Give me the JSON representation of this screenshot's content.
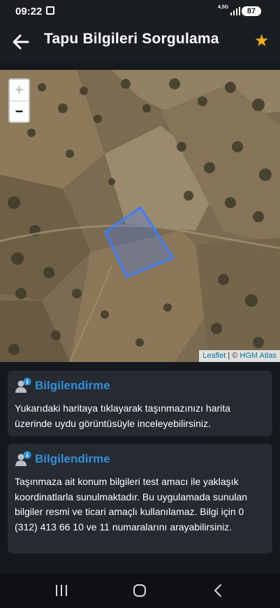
{
  "status": {
    "time": "09:22",
    "network": "4,5G",
    "battery": "87"
  },
  "appbar": {
    "title": "Tapu Bilgileri Sorgulama"
  },
  "map": {
    "zoom_in": "+",
    "zoom_out": "−",
    "attribution_leaflet": "Leaflet",
    "attribution_sep": " | © ",
    "attribution_source": "HGM Atlas"
  },
  "cards": [
    {
      "heading": "Bilgilendirme",
      "body": "Yukarıdaki haritaya tıklayarak taşınmazınızı harita üzerinde uydu görüntüsüyle inceleyebilirsiniz."
    },
    {
      "heading": "Bilgilendirme",
      "body": "Taşınmaza ait konum bilgileri test amacı ile yaklaşık koordinatlarla sunulmaktadır. Bu uygulamada sunulan bilgiler resmi ve ticari amaçlı kullanılamaz. Bilgi için 0 (312) 413 66 10 ve 11 numaralarını arayabilirsiniz."
    }
  ],
  "colors": {
    "accent": "#2f91dc",
    "star": "#f5b014",
    "parcel": "#3d7bff"
  }
}
